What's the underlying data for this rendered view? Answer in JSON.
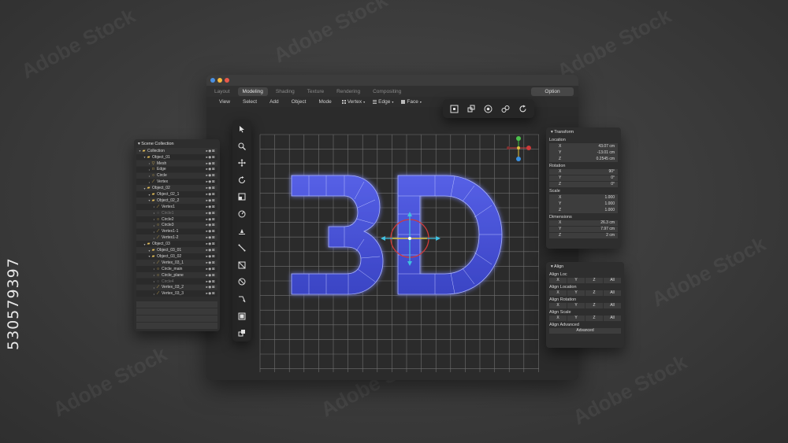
{
  "stock_id": "530579397",
  "watermark": "Adobe Stock",
  "window": {
    "traffic_lights": [
      "#4a90e2",
      "#f5b83d",
      "#e8584a"
    ],
    "tabs": [
      {
        "label": "Layout",
        "active": false
      },
      {
        "label": "Modeling",
        "active": true
      },
      {
        "label": "Shading",
        "active": false
      },
      {
        "label": "Texture",
        "active": false
      },
      {
        "label": "Rendering",
        "active": false
      },
      {
        "label": "Compositing",
        "active": false
      }
    ],
    "option_label": "Option",
    "menu": [
      "View",
      "Select",
      "Add",
      "Object",
      "Mode"
    ],
    "select_modes": [
      {
        "label": "Vertex",
        "icon": "vertex-grid-icon"
      },
      {
        "label": "Edge",
        "icon": "edge-lines-icon"
      },
      {
        "label": "Face",
        "icon": "face-square-icon"
      }
    ]
  },
  "top_tools": [
    "snap-icon",
    "proportional-icon",
    "pivot-icon",
    "link-icon",
    "refresh-icon"
  ],
  "left_tools": [
    "cursor-icon",
    "zoom-icon",
    "move-icon",
    "rotate-icon",
    "scale-icon",
    "transform-icon",
    "annotate-icon",
    "measure-icon",
    "cut-icon",
    "slash-icon",
    "knife-icon",
    "extrude-icon",
    "inset-icon"
  ],
  "scene": {
    "title": "▾ Scene Collection",
    "rows": [
      {
        "label": "Collection",
        "indent": 0,
        "icon": "folder",
        "dim": false
      },
      {
        "label": "Object_01",
        "indent": 1,
        "icon": "folder",
        "dim": false
      },
      {
        "label": "Mesh",
        "indent": 2,
        "icon": "mesh",
        "dim": false
      },
      {
        "label": "Edge",
        "indent": 2,
        "icon": "square",
        "dim": false
      },
      {
        "label": "Circle",
        "indent": 2,
        "icon": "circle",
        "dim": false
      },
      {
        "label": "Vertex",
        "indent": 2,
        "icon": "vertex",
        "dim": false
      },
      {
        "label": "Object_02",
        "indent": 1,
        "icon": "folder",
        "dim": false
      },
      {
        "label": "Object_02_1",
        "indent": 2,
        "icon": "folder",
        "dim": false
      },
      {
        "label": "Object_02_2",
        "indent": 2,
        "icon": "folder",
        "dim": false
      },
      {
        "label": "Vertex1",
        "indent": 3,
        "icon": "vertex",
        "dim": false
      },
      {
        "label": "Circle1",
        "indent": 3,
        "icon": "circle",
        "dim": true
      },
      {
        "label": "Circle2",
        "indent": 3,
        "icon": "circle",
        "dim": false
      },
      {
        "label": "Circle3",
        "indent": 3,
        "icon": "circle",
        "dim": false
      },
      {
        "label": "Vertex1-1",
        "indent": 3,
        "icon": "vertex",
        "dim": false
      },
      {
        "label": "Vertex1-2",
        "indent": 3,
        "icon": "vertex",
        "dim": false
      },
      {
        "label": "Object_03",
        "indent": 1,
        "icon": "folder",
        "dim": false
      },
      {
        "label": "Object_03_01",
        "indent": 2,
        "icon": "folder",
        "dim": false
      },
      {
        "label": "Object_03_02",
        "indent": 2,
        "icon": "folder",
        "dim": false
      },
      {
        "label": "Vertex_03_1",
        "indent": 3,
        "icon": "vertex",
        "dim": false
      },
      {
        "label": "Circle_main",
        "indent": 3,
        "icon": "circle",
        "dim": false
      },
      {
        "label": "Circle_plane",
        "indent": 3,
        "icon": "circle",
        "dim": false
      },
      {
        "label": "Circle4",
        "indent": 3,
        "icon": "circle",
        "dim": true
      },
      {
        "label": "Vertex_03_2",
        "indent": 3,
        "icon": "vertex",
        "dim": false
      },
      {
        "label": "Vertex_03_3",
        "indent": 3,
        "icon": "vertex",
        "dim": false
      }
    ],
    "row_flags": "▸◉⊠"
  },
  "transform": {
    "title": "▾ Transform",
    "sections": [
      {
        "label": "Location",
        "fields": [
          {
            "axis": "X",
            "value": "43.07 cm"
          },
          {
            "axis": "Y",
            "value": "-13.01 cm"
          },
          {
            "axis": "Z",
            "value": "0.2545 cm"
          }
        ]
      },
      {
        "label": "Rotation",
        "fields": [
          {
            "axis": "X",
            "value": "90°"
          },
          {
            "axis": "Y",
            "value": "0°"
          },
          {
            "axis": "Z",
            "value": "0°"
          }
        ]
      },
      {
        "label": "Scale",
        "fields": [
          {
            "axis": "X",
            "value": "1.000"
          },
          {
            "axis": "Y",
            "value": "1.000"
          },
          {
            "axis": "Z",
            "value": "1.000"
          }
        ]
      },
      {
        "label": "Dimensions",
        "fields": [
          {
            "axis": "X",
            "value": "26.3 cm"
          },
          {
            "axis": "Y",
            "value": "7.97 cm"
          },
          {
            "axis": "Z",
            "value": "2 cm"
          }
        ]
      }
    ]
  },
  "align": {
    "title": "▾ Align",
    "sections": [
      {
        "label": "Align Loc",
        "buttons": [
          "X",
          "Y",
          "Z",
          "All"
        ]
      },
      {
        "label": "Align Location",
        "buttons": [
          "X",
          "Y",
          "Z",
          "All"
        ]
      },
      {
        "label": "Align Rotation",
        "buttons": [
          "X",
          "Y",
          "Z",
          "All"
        ]
      },
      {
        "label": "Align Scale",
        "buttons": [
          "X",
          "Y",
          "Z",
          "All"
        ]
      }
    ],
    "advanced_label": "Align Advanced",
    "advanced_button": "Advanced"
  },
  "colors": {
    "mesh_fill": "#4a55d8",
    "mesh_edge": "#aab4ff",
    "gizmo_x": "#d03a3a",
    "gizmo_y": "#40c0e0",
    "gizmo_z": "#e0c040",
    "grid": "#6a6a6a"
  }
}
